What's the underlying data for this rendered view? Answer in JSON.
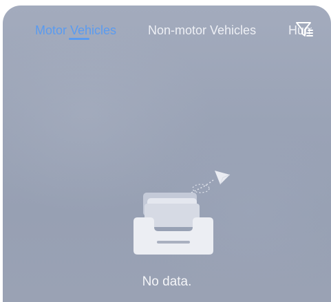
{
  "tabs": [
    {
      "label": "Motor Vehicles",
      "active": true
    },
    {
      "label": "Non-motor Vehicles",
      "active": false
    },
    {
      "label": "Human",
      "active": false
    }
  ],
  "filter": {
    "icon": "filter-list-icon"
  },
  "empty_state": {
    "icon": "empty-tray-with-paper-plane-icon",
    "message": "No data."
  },
  "colors": {
    "accent": "#5a9bf0",
    "panel_background": "#9aa3b6",
    "inactive_tab_text": "#eef0f5"
  }
}
